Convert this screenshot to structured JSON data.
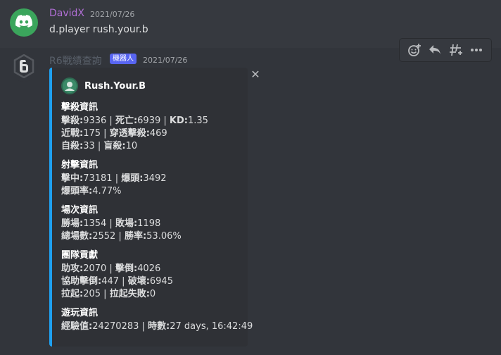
{
  "message1": {
    "username": "DavidX",
    "timestamp": "2021/07/26",
    "content": "d.player rush.your.b",
    "avatar_icon": "discord-logo-icon"
  },
  "message2": {
    "username": "R6戰績查詢",
    "bot_badge": "機器人",
    "timestamp": "2021/07/26",
    "avatar_icon": "rainbow-six-logo-icon",
    "toolbar": [
      "add-reaction-icon",
      "reply-icon",
      "create-thread-icon",
      "more-icon"
    ],
    "embed": {
      "color": "#1ea1f1",
      "author": "Rush.Your.B",
      "sections": [
        {
          "title": "擊殺資訊",
          "lines": [
            [
              [
                "擊殺:",
                "9336"
              ],
              [
                "死亡:",
                "6939"
              ],
              [
                "KD:",
                "1.35"
              ]
            ],
            [
              [
                "近戰:",
                "175"
              ],
              [
                "穿透擊殺:",
                "469"
              ]
            ],
            [
              [
                "自殺:",
                "33"
              ],
              [
                "盲殺:",
                "10"
              ]
            ]
          ]
        },
        {
          "title": "射擊資訊",
          "lines": [
            [
              [
                "擊中:",
                "73181"
              ],
              [
                "爆頭:",
                "3492"
              ]
            ],
            [
              [
                "爆頭率:",
                "4.77%"
              ]
            ]
          ]
        },
        {
          "title": "場次資訊",
          "lines": [
            [
              [
                "勝場:",
                "1354"
              ],
              [
                "敗場:",
                "1198"
              ]
            ],
            [
              [
                "總場數:",
                "2552"
              ],
              [
                "勝率:",
                "53.06%"
              ]
            ]
          ]
        },
        {
          "title": "團隊貢獻",
          "lines": [
            [
              [
                "助攻:",
                "2070"
              ],
              [
                "擊倒:",
                "4026"
              ]
            ],
            [
              [
                "協助擊倒:",
                "447"
              ],
              [
                "破壞:",
                "6945"
              ]
            ],
            [
              [
                "拉起:",
                "205"
              ],
              [
                "拉起失敗:",
                "0"
              ]
            ]
          ]
        },
        {
          "title": "遊玩資訊",
          "lines": [
            [
              [
                "經驗值:",
                "24270283"
              ],
              [
                "時數:",
                "27 days, 16:42:49"
              ]
            ]
          ]
        }
      ]
    }
  }
}
